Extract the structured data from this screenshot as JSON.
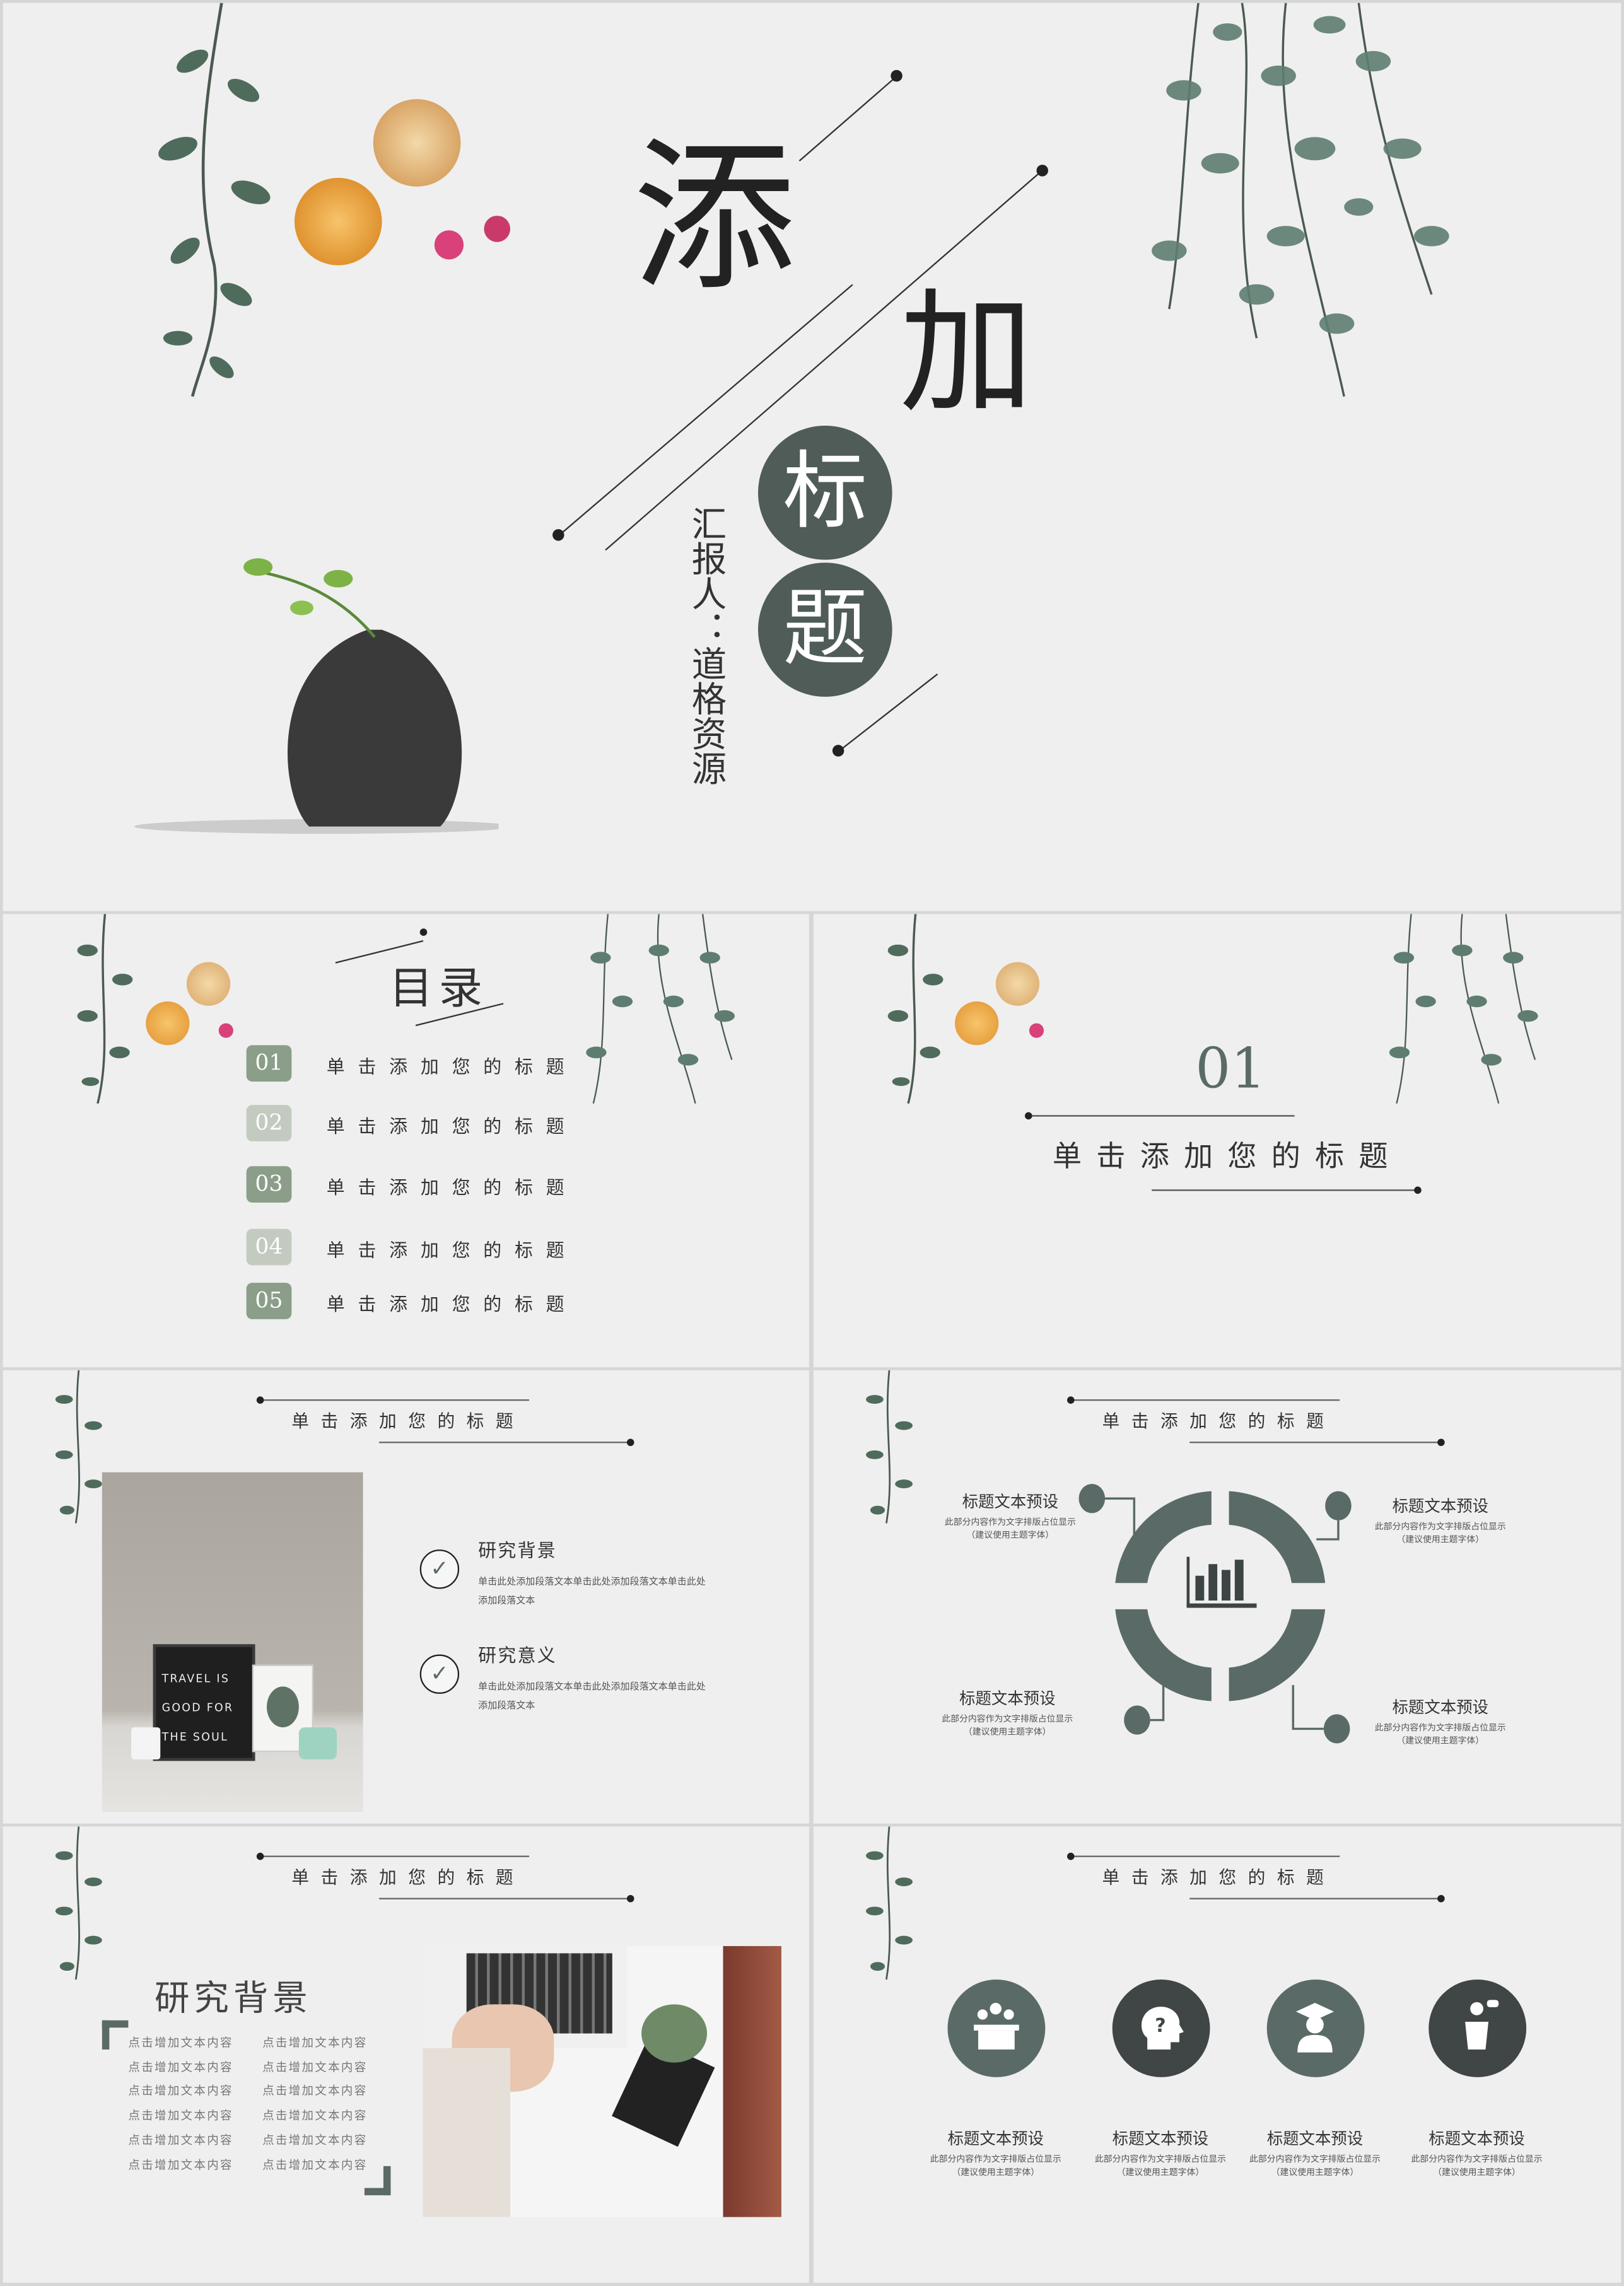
{
  "title_slide": {
    "title_chars": [
      "添",
      "加",
      "标",
      "题"
    ],
    "reporter": "汇报人：道格资源"
  },
  "toc_slide": {
    "title": "目录",
    "items": [
      {
        "number": "01",
        "label": "单击添加您的标题",
        "tone": "dark"
      },
      {
        "number": "02",
        "label": "单击添加您的标题",
        "tone": "light"
      },
      {
        "number": "03",
        "label": "单击添加您的标题",
        "tone": "dark"
      },
      {
        "number": "04",
        "label": "单击添加您的标题",
        "tone": "light"
      },
      {
        "number": "05",
        "label": "单击添加您的标题",
        "tone": "dark"
      }
    ]
  },
  "section_slide": {
    "number": "01",
    "title": "单击添加您的标题"
  },
  "content_slide_1": {
    "header": "单击添加您的标题",
    "photo_text": [
      "TRAVEL IS",
      "GOOD FOR",
      "THE SOUL"
    ],
    "items": [
      {
        "title": "研究背景",
        "body": "单击此处添加段落文本单击此处添加段落文本单击此处添加段落文本"
      },
      {
        "title": "研究意义",
        "body": "单击此处添加段落文本单击此处添加段落文本单击此处添加段落文本"
      }
    ]
  },
  "content_slide_2": {
    "header": "单击添加您的标题",
    "center_icon": "bar-chart-icon",
    "blocks": [
      {
        "title": "标题文本预设",
        "body": "此部分内容作为文字排版占位显示",
        "note": "（建议使用主题字体）"
      },
      {
        "title": "标题文本预设",
        "body": "此部分内容作为文字排版占位显示",
        "note": "（建议使用主题字体）"
      },
      {
        "title": "标题文本预设",
        "body": "此部分内容作为文字排版占位显示",
        "note": "（建议使用主题字体）"
      },
      {
        "title": "标题文本预设",
        "body": "此部分内容作为文字排版占位显示",
        "note": "（建议使用主题字体）"
      }
    ]
  },
  "content_slide_3": {
    "header": "单击添加您的标题",
    "title": "研究背景",
    "left_column": [
      "点击增加文本内容",
      "点击增加文本内容",
      "点击增加文本内容",
      "点击增加文本内容",
      "点击增加文本内容",
      "点击增加文本内容"
    ],
    "right_column": [
      "点击增加文本内容",
      "点击增加文本内容",
      "点击增加文本内容",
      "点击增加文本内容",
      "点击增加文本内容",
      "点击增加文本内容"
    ]
  },
  "content_slide_4": {
    "header": "单击添加您的标题",
    "items": [
      {
        "icon": "meeting-icon",
        "title": "标题文本预设",
        "body": "此部分内容作为文字排版占位显示",
        "note": "（建议使用主题字体）"
      },
      {
        "icon": "question-head-icon",
        "title": "标题文本预设",
        "body": "此部分内容作为文字排版占位显示",
        "note": "（建议使用主题字体）"
      },
      {
        "icon": "graduate-icon",
        "title": "标题文本预设",
        "body": "此部分内容作为文字排版占位显示",
        "note": "（建议使用主题字体）"
      },
      {
        "icon": "speaker-podium-icon",
        "title": "标题文本预设",
        "body": "此部分内容作为文字排版占位显示",
        "note": "（建议使用主题字体）"
      }
    ]
  },
  "colors": {
    "background": "#efefef",
    "accent": "#5a6b67",
    "badge_dark": "#8a9e89",
    "badge_light": "#c3cbc1"
  }
}
